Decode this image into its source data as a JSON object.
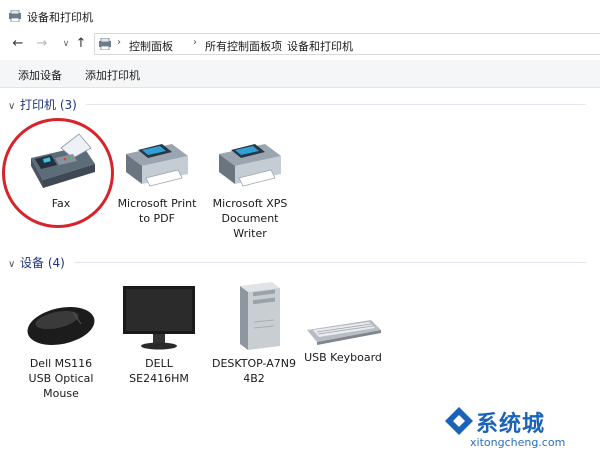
{
  "window": {
    "title": "设备和打印机"
  },
  "nav": {
    "back_glyph": "←",
    "forward_glyph": "→",
    "dropdown_glyph": "∨",
    "up_glyph": "↑",
    "separator": "›",
    "breadcrumbs": [
      "控制面板",
      "所有控制面板项",
      "设备和打印机"
    ]
  },
  "toolbar": {
    "add_device": "添加设备",
    "add_printer": "添加打印机"
  },
  "groups": {
    "printers": {
      "header": "打印机 (3)",
      "items": [
        {
          "label": "Fax",
          "icon": "fax-icon"
        },
        {
          "label": "Microsoft Print\nto PDF",
          "icon": "printer-icon"
        },
        {
          "label": "Microsoft XPS\nDocument\nWriter",
          "icon": "printer-icon"
        }
      ]
    },
    "devices": {
      "header": "设备 (4)",
      "items": [
        {
          "label": "Dell MS116\nUSB Optical\nMouse",
          "icon": "mouse-icon"
        },
        {
          "label": "DELL\nSE2416HM",
          "icon": "monitor-icon"
        },
        {
          "label": "DESKTOP-A7N9\n4B2",
          "icon": "computer-tower-icon"
        },
        {
          "label": "USB Keyboard",
          "icon": "keyboard-icon"
        }
      ]
    }
  },
  "watermark": {
    "main": "系统城",
    "sub": "xitongcheng.com"
  },
  "colors": {
    "group_header": "#1e3287",
    "annotation_circle": "#d8232a",
    "watermark": "#1b63b7"
  }
}
